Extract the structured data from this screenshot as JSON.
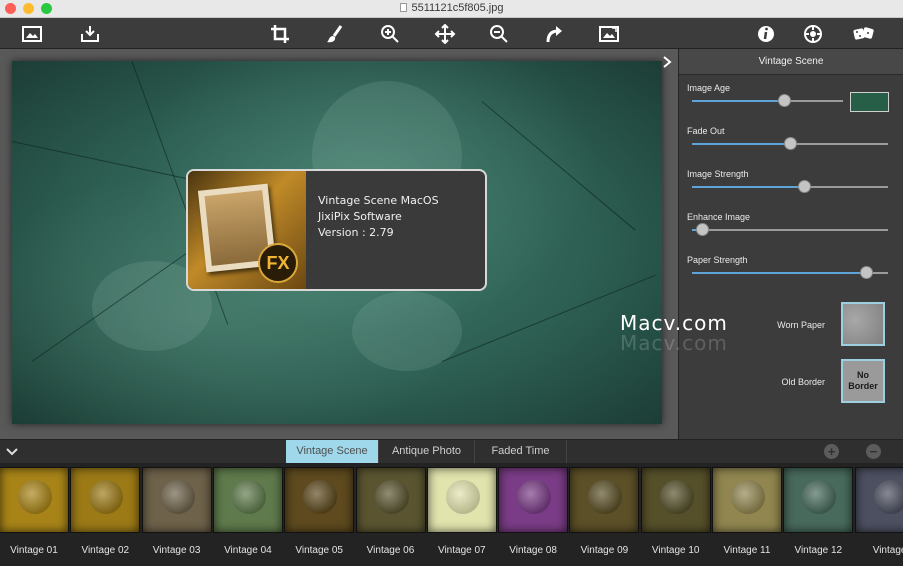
{
  "window": {
    "title": "5511121c5f805.jpg"
  },
  "colors": {
    "accent_tab": "#9ed8ea",
    "slider_fill": "#5fa4d8",
    "image_age_swatch": "#275e47"
  },
  "toolbar": {
    "icons": [
      "open-image-icon",
      "save-icon",
      "crop-icon",
      "brush-icon",
      "zoom-in-icon",
      "move-icon",
      "zoom-out-icon",
      "redo-icon",
      "export-image-icon",
      "info-icon",
      "settings-icon",
      "random-dice-icon"
    ]
  },
  "about": {
    "app_name": "Vintage Scene MacOS",
    "company": "JixiPix Software",
    "version": "Version : 2.79",
    "logo_text": "FX"
  },
  "watermark": {
    "text": "Macv.com"
  },
  "panel": {
    "title": "Vintage Scene",
    "sliders": [
      {
        "label": "Image Age",
        "value": 0.62
      },
      {
        "label": "Fade Out",
        "value": 0.5
      },
      {
        "label": "Image Strength",
        "value": 0.58
      },
      {
        "label": "Enhance Image",
        "value": 0.02
      },
      {
        "label": "Paper Strength",
        "value": 0.92
      }
    ],
    "worn_paper_label": "Worn Paper",
    "old_border_label": "Old Border",
    "no_border_text": "No Border"
  },
  "tabs": [
    {
      "label": "Vintage Scene",
      "active": true
    },
    {
      "label": "Antique Photo",
      "active": false
    },
    {
      "label": "Faded Time",
      "active": false
    }
  ],
  "presets": [
    {
      "label": "Vintage 01",
      "color": "#a88418"
    },
    {
      "label": "Vintage 02",
      "color": "#9c7a16"
    },
    {
      "label": "Vintage 03",
      "color": "#6e624a"
    },
    {
      "label": "Vintage 04",
      "color": "#5f7a4c"
    },
    {
      "label": "Vintage 05",
      "color": "#5e4a1e"
    },
    {
      "label": "Vintage 06",
      "color": "#5a5530"
    },
    {
      "label": "Vintage 07",
      "color": "#e2e4ae"
    },
    {
      "label": "Vintage 08",
      "color": "#7a3c86"
    },
    {
      "label": "Vintage 09",
      "color": "#5c5028"
    },
    {
      "label": "Vintage 10",
      "color": "#55502a"
    },
    {
      "label": "Vintage 11",
      "color": "#918650"
    },
    {
      "label": "Vintage 12",
      "color": "#486a5c"
    },
    {
      "label": "Vintage",
      "color": "#4c5060"
    }
  ]
}
